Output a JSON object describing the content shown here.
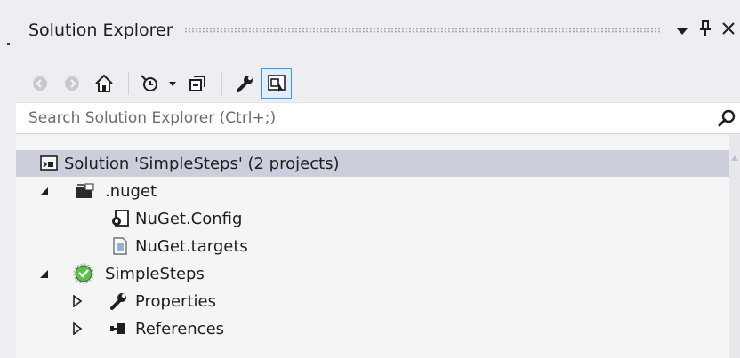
{
  "panel": {
    "title": "Solution Explorer",
    "dropdown_glyph": "▾",
    "pin_glyph": "ᵖ",
    "close_glyph": "✕"
  },
  "toolbar": {
    "buttons": [
      {
        "name": "back-icon"
      },
      {
        "name": "forward-icon"
      },
      {
        "name": "home-icon"
      },
      {
        "name": "pending-changes-filter-icon"
      },
      {
        "name": "collapse-all-icon"
      },
      {
        "name": "properties-icon"
      },
      {
        "name": "preview-selected-items-icon"
      }
    ],
    "dropdown_caret": "▾"
  },
  "search": {
    "placeholder": "Search Solution Explorer (Ctrl+;)"
  },
  "tree": {
    "solution": {
      "label": "Solution 'SimpleSteps' (2 projects)"
    },
    "nuget_folder": {
      "label": ".nuget",
      "expanded": true
    },
    "nuget_config": {
      "label": "NuGet.Config"
    },
    "nuget_targets": {
      "label": "NuGet.targets"
    },
    "project": {
      "label": "SimpleSteps",
      "expanded": true
    },
    "properties": {
      "label": "Properties",
      "expanded": false
    },
    "references": {
      "label": "References",
      "expanded": false
    }
  },
  "colors": {
    "selection": "#cccedb",
    "accent": "#3399ff",
    "background": "#eeeef2"
  }
}
